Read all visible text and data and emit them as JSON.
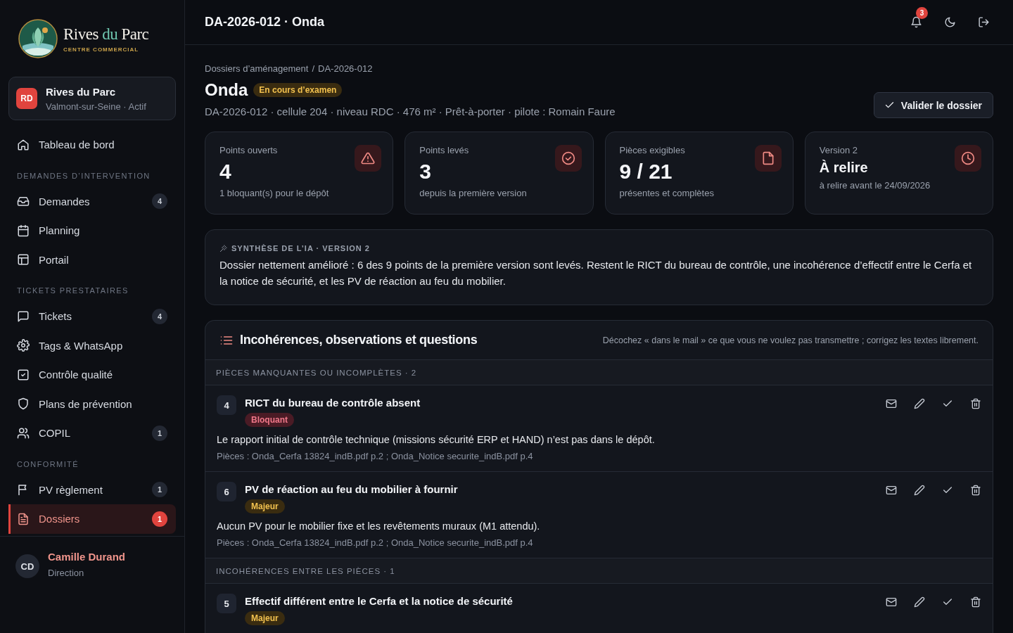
{
  "logo": {
    "name_start": "Rives",
    "name_accent": "du",
    "name_end": "Parc",
    "tagline": "CENTRE COMMERCIAL"
  },
  "site": {
    "initials": "RD",
    "name": "Rives du Parc",
    "subtitle": "Valmont-sur-Seine · Actif"
  },
  "sidebar": {
    "items": [
      {
        "kind": "link",
        "label": "Tableau de bord",
        "selected": false
      },
      {
        "kind": "section",
        "label": "DEMANDES D’INTERVENTION"
      },
      {
        "kind": "link",
        "label": "Demandes",
        "badge": "4",
        "selected": false
      },
      {
        "kind": "link",
        "label": "Planning",
        "selected": false
      },
      {
        "kind": "link",
        "label": "Portail",
        "selected": false
      },
      {
        "kind": "section",
        "label": "TICKETS PRESTATAIRES"
      },
      {
        "kind": "link",
        "label": "Tickets",
        "badge": "4",
        "selected": false
      },
      {
        "kind": "link",
        "label": "Tags & WhatsApp",
        "selected": false
      },
      {
        "kind": "link",
        "label": "Contrôle qualité",
        "selected": false
      },
      {
        "kind": "link",
        "label": "Plans de prévention",
        "selected": false
      },
      {
        "kind": "link",
        "label": "COPIL",
        "badge": "1",
        "selected": false
      },
      {
        "kind": "section",
        "label": "CONFORMITÉ"
      },
      {
        "kind": "link",
        "label": "PV règlement",
        "badge": "1",
        "selected": false
      },
      {
        "kind": "link",
        "label": "Dossiers",
        "badge": "1",
        "selected": true
      }
    ]
  },
  "user": {
    "initials": "CD",
    "name": "Camille Durand",
    "role": "Direction"
  },
  "header": {
    "title": "DA-2026-012 · Onda",
    "notifications": "3"
  },
  "breadcrumb": {
    "items": [
      "Dossiers d’aménagement",
      "DA-2026-012"
    ],
    "separator": "/"
  },
  "dossier": {
    "name": "Onda",
    "status": "En cours d’examen",
    "meta": "DA-2026-012 · cellule 204 · niveau RDC · 476 m² · Prêt-à-porter · pilote : Romain Faure",
    "action": "Valider le dossier"
  },
  "stats": [
    {
      "label": "Points ouverts",
      "value": "4",
      "note": "1 bloquant(s) pour le dépôt"
    },
    {
      "label": "Points levés",
      "value": "3",
      "note": "depuis la première version"
    },
    {
      "label": "Pièces exigibles",
      "value": "9 / 21",
      "note": "présentes et complètes"
    },
    {
      "label": "Version 2",
      "value": "À relire",
      "note": "à relire avant le 24/09/2026"
    }
  ],
  "summary": {
    "title": "SYNTHÈSE DE L’IA · VERSION 2",
    "text": "Dossier nettement amélioré : 6 des 9 points de la première version sont levés. Restent le RICT du bureau de contrôle, une incohérence d’effectif entre le Cerfa et la notice de sécurité, et les PV de réaction au feu du mobilier."
  },
  "issues": {
    "title": "Incohérences, observations et questions",
    "hint": "Décochez « dans le mail » ce que vous ne voulez pas transmettre ; corrigez les textes librement.",
    "groups": [
      {
        "title": "PIÈCES MANQUANTES OU INCOMPLÈTES · 2",
        "items": [
          {
            "number": "4",
            "title": "RICT du bureau de contrôle absent",
            "severity": {
              "kind": "blocking",
              "label": "Bloquant"
            },
            "description": "Le rapport initial de contrôle technique (missions sécurité ERP et HAND) n’est pas dans le dépôt.",
            "pieces": "Pièces : Onda_Cerfa 13824_indB.pdf p.2 ; Onda_Notice securite_indB.pdf p.4"
          },
          {
            "number": "6",
            "title": "PV de réaction au feu du mobilier à fournir",
            "severity": {
              "kind": "major",
              "label": "Majeur"
            },
            "description": "Aucun PV pour le mobilier fixe et les revêtements muraux (M1 attendu).",
            "pieces": "Pièces : Onda_Cerfa 13824_indB.pdf p.2 ; Onda_Notice securite_indB.pdf p.4"
          }
        ]
      },
      {
        "title": "INCOHÉRENCES ENTRE LES PIÈCES · 1",
        "items": [
          {
            "number": "5",
            "title": "Effectif différent entre le Cerfa et la notice de sécurité",
            "severity": {
              "kind": "major",
              "label": "Majeur"
            }
          }
        ]
      }
    ]
  }
}
